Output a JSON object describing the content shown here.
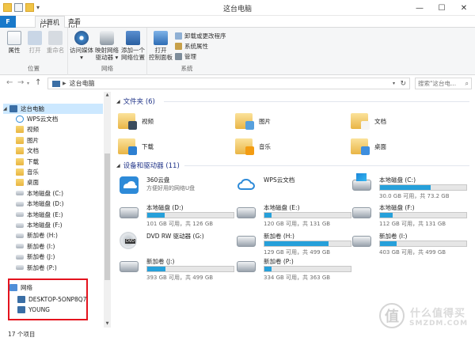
{
  "window": {
    "title": "这台电脑",
    "min_glyph": "—",
    "max_glyph": "☐",
    "close_glyph": "✕"
  },
  "ribbon_tabs": {
    "file": "F",
    "computer": "计算机",
    "view": "查看",
    "keytip_computer": "C",
    "keytip_view": "V"
  },
  "ribbon": {
    "location": {
      "label": "位置",
      "properties": "属性",
      "open": "打开",
      "rename": "重命名"
    },
    "network": {
      "label": "网络",
      "access_media_1": "访问媒体",
      "access_media_2": "▾",
      "map_drive_1": "映射网络",
      "map_drive_2": "驱动器 ▾",
      "add_location_1": "添加一个",
      "add_location_2": "网络位置"
    },
    "system": {
      "label": "系统",
      "control_panel_1": "打开",
      "control_panel_2": "控制面板",
      "uninstall": "卸载或更改程序",
      "sys_props": "系统属性",
      "manage": "管理"
    }
  },
  "address": {
    "path": "这台电脑",
    "search_placeholder": "搜索\"这台电...",
    "back": "←",
    "forward": "→",
    "up": "↑"
  },
  "nav": {
    "this_pc": "这台电脑",
    "items": [
      {
        "label": "WPS云文档",
        "icon": "cloud-icon"
      },
      {
        "label": "视频",
        "icon": "folder-icon"
      },
      {
        "label": "图片",
        "icon": "folder-icon"
      },
      {
        "label": "文档",
        "icon": "folder-icon"
      },
      {
        "label": "下载",
        "icon": "folder-icon"
      },
      {
        "label": "音乐",
        "icon": "folder-icon"
      },
      {
        "label": "桌面",
        "icon": "folder-icon"
      },
      {
        "label": "本地磁盘 (C:)",
        "icon": "drive-icon"
      },
      {
        "label": "本地磁盘 (D:)",
        "icon": "drive-icon"
      },
      {
        "label": "本地磁盘 (E:)",
        "icon": "drive-icon"
      },
      {
        "label": "本地磁盘 (F:)",
        "icon": "drive-icon"
      },
      {
        "label": "新加卷 (H:)",
        "icon": "drive-icon"
      },
      {
        "label": "新加卷 (I:)",
        "icon": "drive-icon"
      },
      {
        "label": "新加卷 (J:)",
        "icon": "drive-icon"
      },
      {
        "label": "新加卷 (P:)",
        "icon": "drive-icon"
      }
    ],
    "network": "网络",
    "network_items": [
      {
        "label": "DESKTOP-5ONP8Q7"
      },
      {
        "label": "YOUNG"
      }
    ]
  },
  "sections": {
    "folders_header": "文件夹 (6)",
    "devices_header": "设备和驱动器 (11)"
  },
  "folders": [
    {
      "label": "视频",
      "icon": "video-folder-icon"
    },
    {
      "label": "图片",
      "icon": "pictures-folder-icon"
    },
    {
      "label": "文档",
      "icon": "documents-folder-icon"
    },
    {
      "label": "下载",
      "icon": "downloads-folder-icon"
    },
    {
      "label": "音乐",
      "icon": "music-folder-icon"
    },
    {
      "label": "桌面",
      "icon": "desktop-folder-icon"
    }
  ],
  "drives": [
    {
      "name": "360云盘",
      "free": "方便好用的网络U盘",
      "icon": "cloud-drive-icon",
      "used_pct": null
    },
    {
      "name": "WPS云文档",
      "free": "",
      "icon": "wps-cloud-icon",
      "used_pct": null
    },
    {
      "name": "本地磁盘 (C:)",
      "free": "30.0 GB 可用，共 73.2 GB",
      "icon": "system-drive-icon",
      "used_pct": 59
    },
    {
      "name": "本地磁盘 (D:)",
      "free": "101 GB 可用，共 126 GB",
      "icon": "drive-icon",
      "used_pct": 20
    },
    {
      "name": "本地磁盘 (E:)",
      "free": "120 GB 可用，共 131 GB",
      "icon": "drive-icon",
      "used_pct": 8
    },
    {
      "name": "本地磁盘 (F:)",
      "free": "112 GB 可用，共 131 GB",
      "icon": "drive-icon",
      "used_pct": 15
    },
    {
      "name": "DVD RW 驱动器 (G:)",
      "free": "",
      "icon": "dvd-drive-icon",
      "used_pct": null
    },
    {
      "name": "新加卷 (H:)",
      "free": "129 GB 可用，共 499 GB",
      "icon": "drive-icon",
      "used_pct": 74
    },
    {
      "name": "新加卷 (I:)",
      "free": "403 GB 可用，共 499 GB",
      "icon": "drive-icon",
      "used_pct": 19
    },
    {
      "name": "新加卷 (J:)",
      "free": "393 GB 可用，共 499 GB",
      "icon": "drive-icon",
      "used_pct": 21
    },
    {
      "name": "新加卷 (P:)",
      "free": "334 GB 可用，共 363 GB",
      "icon": "drive-icon",
      "used_pct": 8
    }
  ],
  "status": {
    "count": "17 个项目"
  },
  "watermark": {
    "badge": "值",
    "text": "什么值得买",
    "sub": "SMZDM.COM"
  },
  "colors": {
    "accent": "#1979ca",
    "bar_fill": "#26a0da",
    "highlight_box": "#e4131e"
  }
}
